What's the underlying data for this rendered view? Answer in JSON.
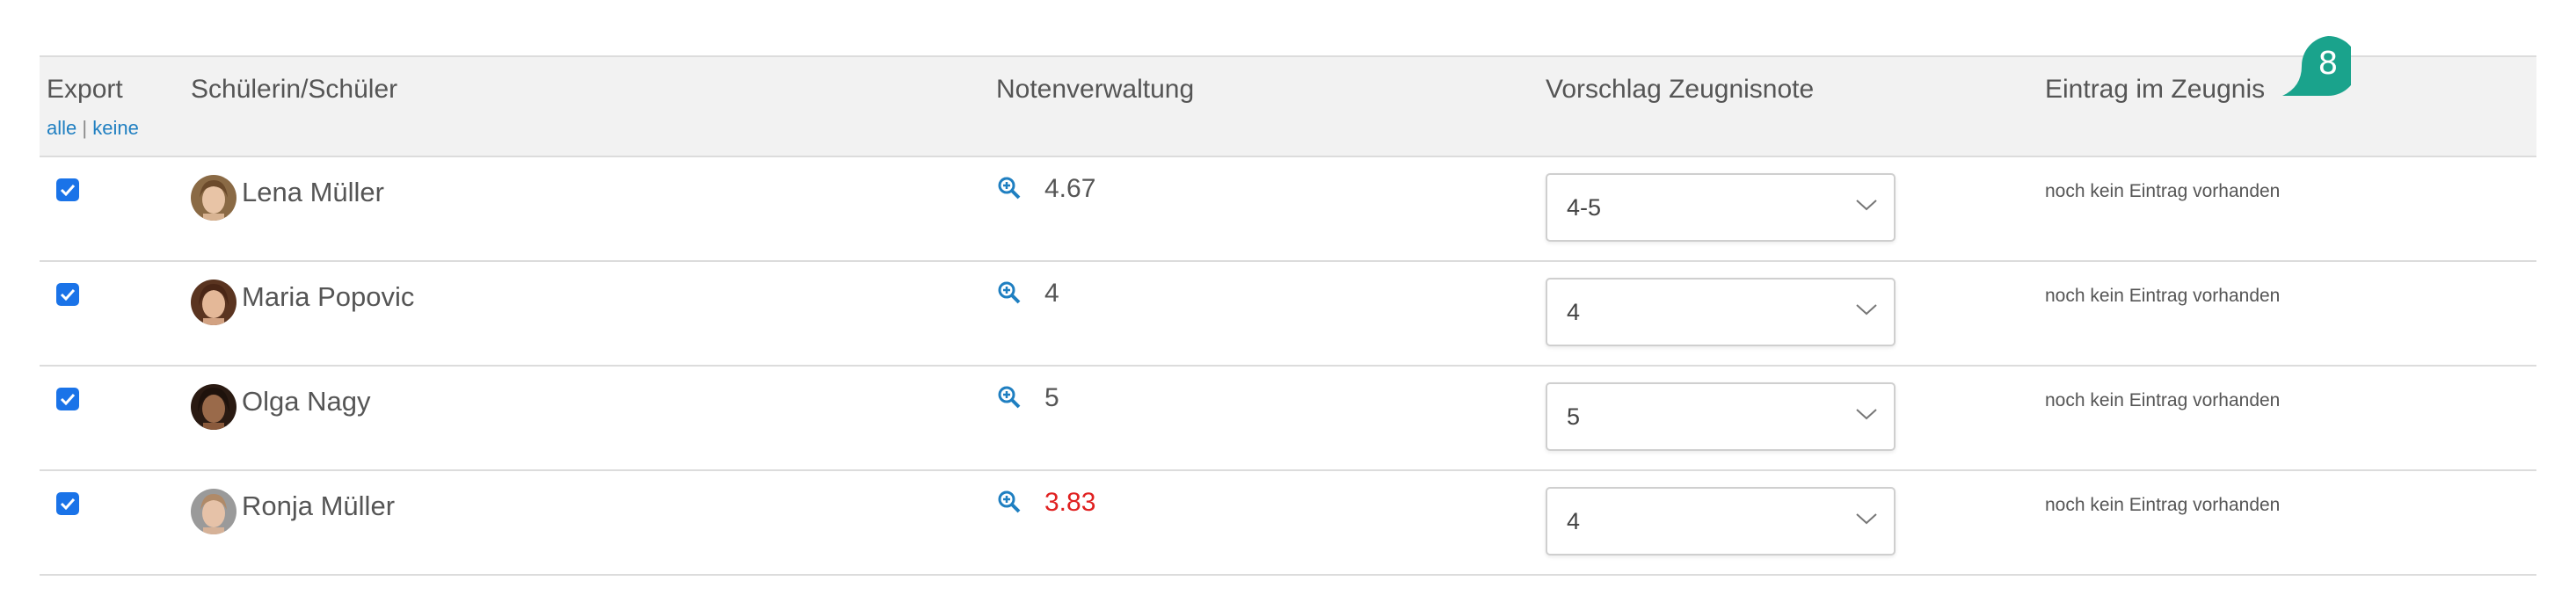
{
  "header": {
    "export": "Export",
    "select_all": "alle",
    "separator": "|",
    "select_none": "keine",
    "student": "Schülerin/Schüler",
    "grades": "Notenverwaltung",
    "proposal": "Vorschlag Zeugnisnote",
    "entry": "Eintrag im Zeugnis"
  },
  "badge": {
    "number": "8",
    "color": "#1aa38c"
  },
  "colors": {
    "accent": "#1a73e8",
    "link": "#1f7fc1",
    "warning": "#e02020"
  },
  "rows": [
    {
      "checked": true,
      "name": "Lena Müller",
      "average": "4.67",
      "average_warning": false,
      "proposal": "4-5",
      "entry": "noch kein Eintrag vorhanden"
    },
    {
      "checked": true,
      "name": "Maria Popovic",
      "average": "4",
      "average_warning": false,
      "proposal": "4",
      "entry": "noch kein Eintrag vorhanden"
    },
    {
      "checked": true,
      "name": "Olga Nagy",
      "average": "5",
      "average_warning": false,
      "proposal": "5",
      "entry": "noch kein Eintrag vorhanden"
    },
    {
      "checked": true,
      "name": "Ronja Müller",
      "average": "3.83",
      "average_warning": true,
      "proposal": "4",
      "entry": "noch kein Eintrag vorhanden"
    }
  ]
}
